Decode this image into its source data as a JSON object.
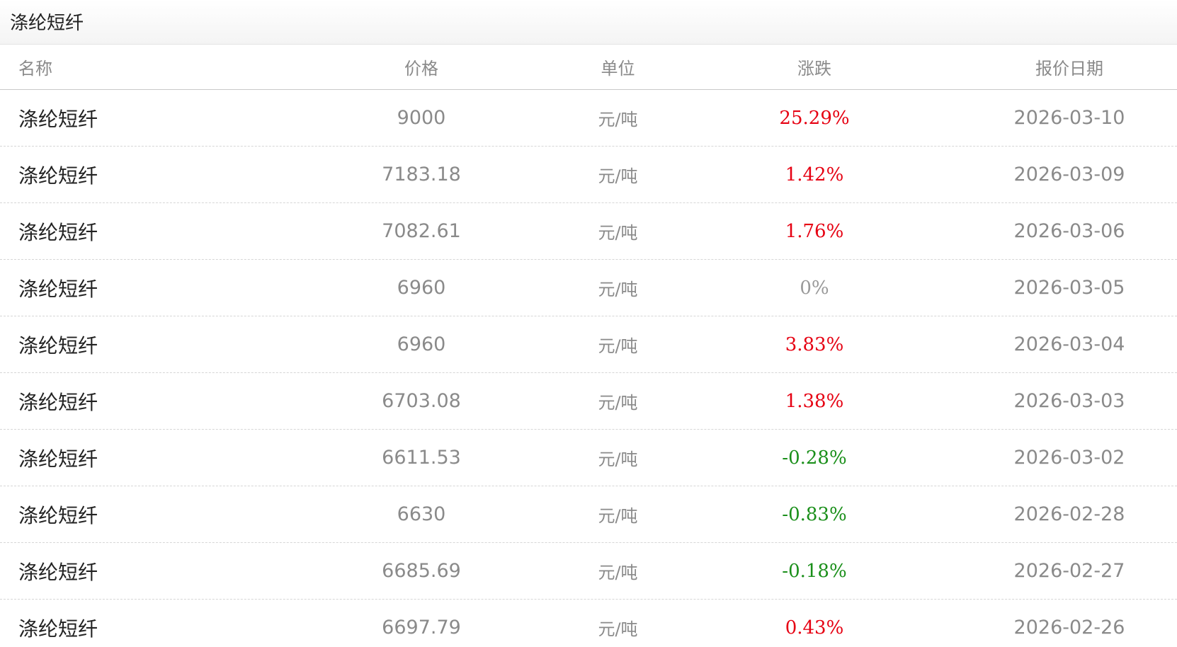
{
  "panel": {
    "title": "涤纶短纤"
  },
  "table": {
    "columns": {
      "name": "名称",
      "price": "价格",
      "unit": "单位",
      "change": "涨跌",
      "date": "报价日期"
    },
    "rows": [
      {
        "name": "涤纶短纤",
        "price": "9000",
        "unit": "元/吨",
        "change": "25.29%",
        "direction": "up",
        "date": "2026-03-10"
      },
      {
        "name": "涤纶短纤",
        "price": "7183.18",
        "unit": "元/吨",
        "change": "1.42%",
        "direction": "up",
        "date": "2026-03-09"
      },
      {
        "name": "涤纶短纤",
        "price": "7082.61",
        "unit": "元/吨",
        "change": "1.76%",
        "direction": "up",
        "date": "2026-03-06"
      },
      {
        "name": "涤纶短纤",
        "price": "6960",
        "unit": "元/吨",
        "change": "0%",
        "direction": "flat",
        "date": "2026-03-05"
      },
      {
        "name": "涤纶短纤",
        "price": "6960",
        "unit": "元/吨",
        "change": "3.83%",
        "direction": "up",
        "date": "2026-03-04"
      },
      {
        "name": "涤纶短纤",
        "price": "6703.08",
        "unit": "元/吨",
        "change": "1.38%",
        "direction": "up",
        "date": "2026-03-03"
      },
      {
        "name": "涤纶短纤",
        "price": "6611.53",
        "unit": "元/吨",
        "change": "-0.28%",
        "direction": "down",
        "date": "2026-03-02"
      },
      {
        "name": "涤纶短纤",
        "price": "6630",
        "unit": "元/吨",
        "change": "-0.83%",
        "direction": "down",
        "date": "2026-02-28"
      },
      {
        "name": "涤纶短纤",
        "price": "6685.69",
        "unit": "元/吨",
        "change": "-0.18%",
        "direction": "down",
        "date": "2026-02-27"
      },
      {
        "name": "涤纶短纤",
        "price": "6697.79",
        "unit": "元/吨",
        "change": "0.43%",
        "direction": "up",
        "date": "2026-02-26"
      }
    ]
  },
  "colors": {
    "up": "#e60012",
    "down": "#1a8f1a",
    "flat": "#999999",
    "muted_text": "#8a8a8a",
    "dark_text": "#222222"
  }
}
